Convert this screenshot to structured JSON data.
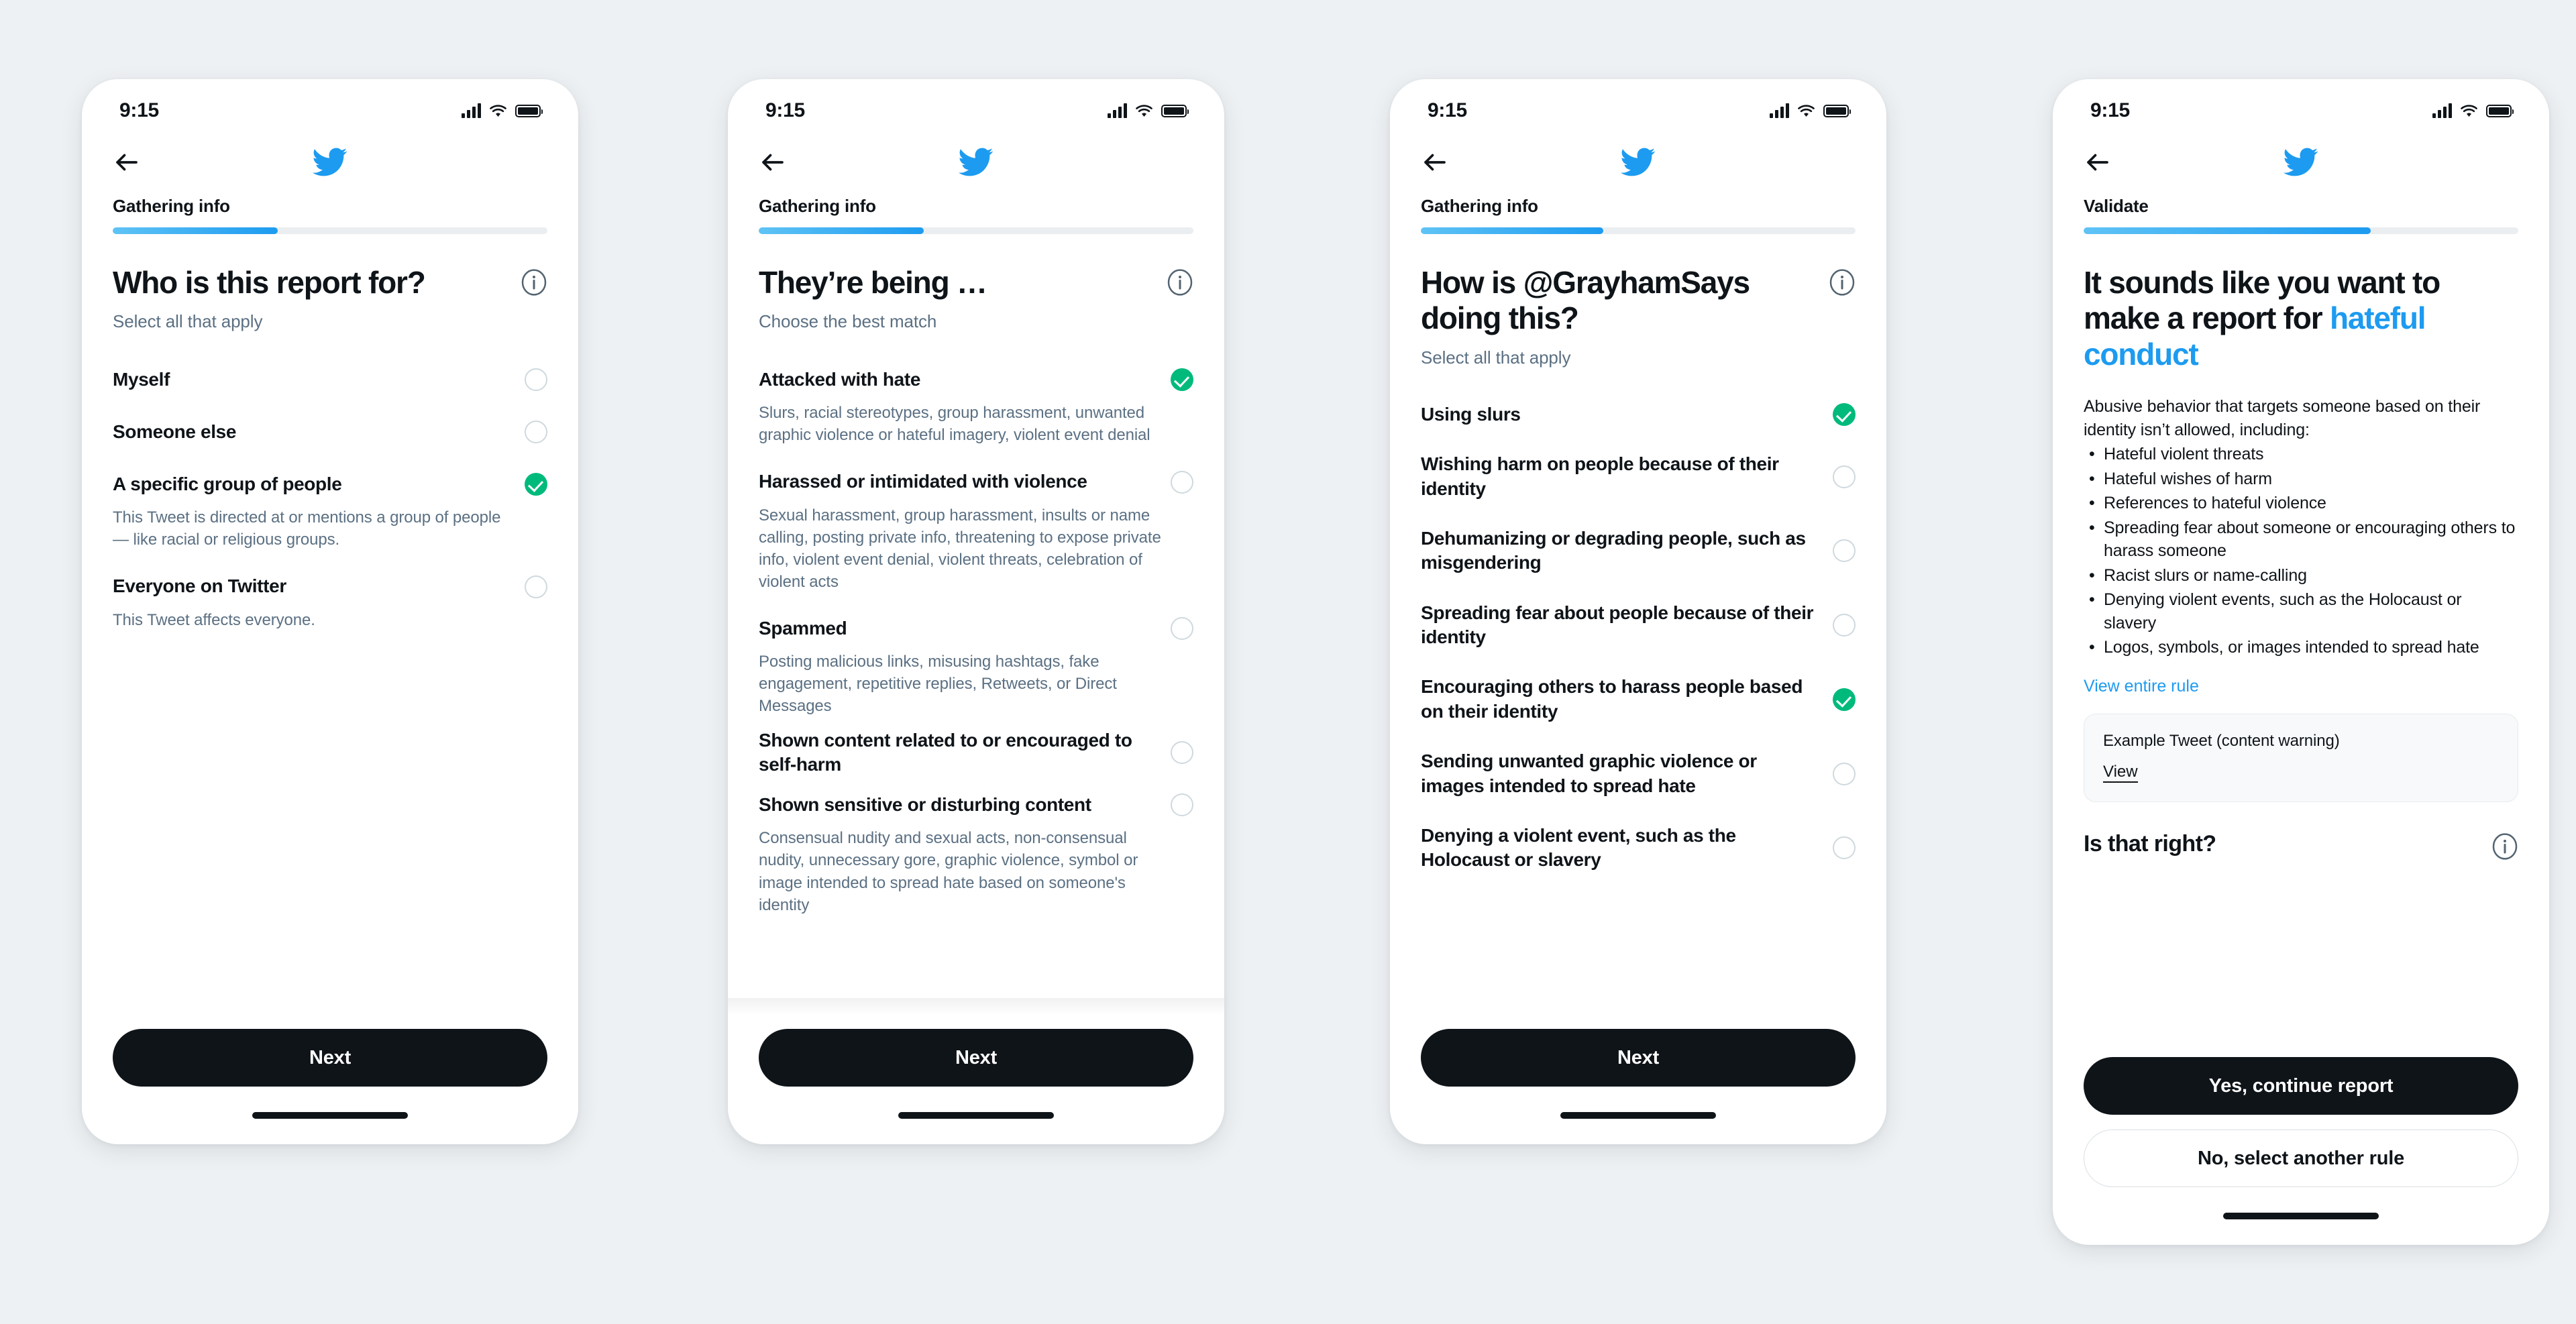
{
  "statusbar": {
    "time": "9:15"
  },
  "icons": {
    "back": "back-arrow-icon",
    "logo": "twitter-bird-icon",
    "info": "info-icon",
    "signal": "cellular-signal-icon",
    "wifi": "wifi-icon",
    "battery": "battery-icon"
  },
  "colors": {
    "accent_blue": "#1d9bf0",
    "selected_green": "#00ba7c",
    "text_primary": "#0f1419",
    "text_secondary": "#5b7083",
    "page_background": "#eef1f3",
    "button_dark": "#0f1419"
  },
  "screens": [
    {
      "progress": {
        "label": "Gathering info",
        "percent": 38
      },
      "title": "Who is this report for?",
      "subtitle": "Select all that apply",
      "options": [
        {
          "label": "Myself",
          "desc": "",
          "selected": false
        },
        {
          "label": "Someone else",
          "desc": "",
          "selected": false
        },
        {
          "label": "A specific group of people",
          "desc": "This Tweet is directed at or mentions a group of people — like racial or religious groups.",
          "selected": true
        },
        {
          "label": "Everyone on Twitter",
          "desc": "This Tweet affects everyone.",
          "selected": false
        }
      ],
      "next_label": "Next"
    },
    {
      "progress": {
        "label": "Gathering info",
        "percent": 38
      },
      "title": "They’re being …",
      "subtitle": "Choose the best match",
      "options": [
        {
          "label": "Attacked with hate",
          "desc": "Slurs, racial stereotypes, group harassment, unwanted graphic violence or hateful imagery, violent event denial",
          "selected": true
        },
        {
          "label": "Harassed or intimidated with violence",
          "desc": "Sexual harassment, group harassment, insults or name calling, posting private info, threatening to expose private info, violent event denial, violent threats, celebration of violent acts",
          "selected": false
        },
        {
          "label": "Spammed",
          "desc": "Posting malicious links, misusing hashtags, fake engagement, repetitive replies, Retweets, or Direct Messages",
          "selected": false
        },
        {
          "label": "Shown content related to or encouraged to self-harm",
          "desc": "",
          "selected": false
        },
        {
          "label": "Shown sensitive or disturbing content",
          "desc": "Consensual nudity and sexual acts, non-consensual nudity, unnecessary gore, graphic violence, symbol or image intended to spread hate based on someone's identity",
          "selected": false
        }
      ],
      "next_label": "Next"
    },
    {
      "progress": {
        "label": "Gathering info",
        "percent": 42
      },
      "title": "How is @GrayhamSays doing this?",
      "subtitle": "Select all that apply",
      "options": [
        {
          "label": "Using slurs",
          "desc": "",
          "selected": true
        },
        {
          "label": "Wishing harm on people because of their identity",
          "desc": "",
          "selected": false
        },
        {
          "label": "Dehumanizing or degrading people, such as misgendering",
          "desc": "",
          "selected": false
        },
        {
          "label": "Spreading fear about people because of their identity",
          "desc": "",
          "selected": false
        },
        {
          "label": "Encouraging others to harass people based on their identity",
          "desc": "",
          "selected": true
        },
        {
          "label": "Sending unwanted graphic violence or images intended to spread hate",
          "desc": "",
          "selected": false
        },
        {
          "label": "Denying a violent event, such as the Holocaust or slavery",
          "desc": "",
          "selected": false
        }
      ],
      "next_label": "Next"
    },
    {
      "progress": {
        "label": "Validate",
        "percent": 66
      },
      "title_plain": "It sounds like you want to make a report for ",
      "title_accent": "hateful conduct",
      "intro": "Abusive behavior that targets someone based on their identity isn’t allowed, including:",
      "bullets": [
        "Hateful violent threats",
        "Hateful wishes of harm",
        "References to hateful violence",
        "Spreading fear about someone or encouraging others to harass someone",
        "Racist slurs or name-calling",
        "Denying violent events, such as the Holocaust or slavery",
        "Logos, symbols, or images intended to spread hate"
      ],
      "view_rule_label": "View entire rule",
      "example_card": {
        "title": "Example Tweet (content warning)",
        "view_label": "View"
      },
      "confirm_title": "Is that right?",
      "primary_label": "Yes, continue report",
      "secondary_label": "No, select another rule"
    }
  ]
}
